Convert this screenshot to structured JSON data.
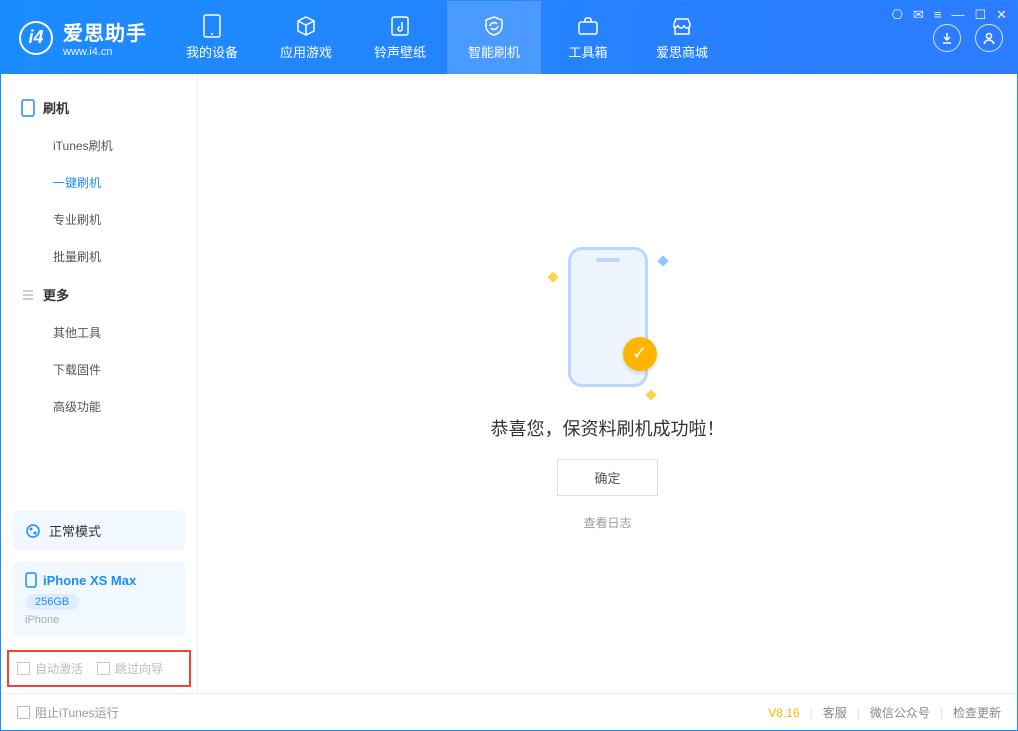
{
  "app": {
    "name_cn": "爱思助手",
    "url": "www.i4.cn"
  },
  "tabs": [
    {
      "label": "我的设备"
    },
    {
      "label": "应用游戏"
    },
    {
      "label": "铃声壁纸"
    },
    {
      "label": "智能刷机"
    },
    {
      "label": "工具箱"
    },
    {
      "label": "爱思商城"
    }
  ],
  "sidebar": {
    "group1": {
      "title": "刷机",
      "items": [
        "iTunes刷机",
        "一键刷机",
        "专业刷机",
        "批量刷机"
      ]
    },
    "group2": {
      "title": "更多",
      "items": [
        "其他工具",
        "下载固件",
        "高级功能"
      ]
    }
  },
  "mode": {
    "label": "正常模式"
  },
  "device": {
    "name": "iPhone XS Max",
    "capacity": "256GB",
    "type": "iPhone"
  },
  "options": {
    "auto_activate": "自动激活",
    "skip_guide": "跳过向导"
  },
  "main": {
    "message": "恭喜您，保资料刷机成功啦！",
    "ok": "确定",
    "view_log": "查看日志"
  },
  "footer": {
    "block_itunes": "阻止iTunes运行",
    "version": "V8.16",
    "links": [
      "客服",
      "微信公众号",
      "检查更新"
    ]
  }
}
